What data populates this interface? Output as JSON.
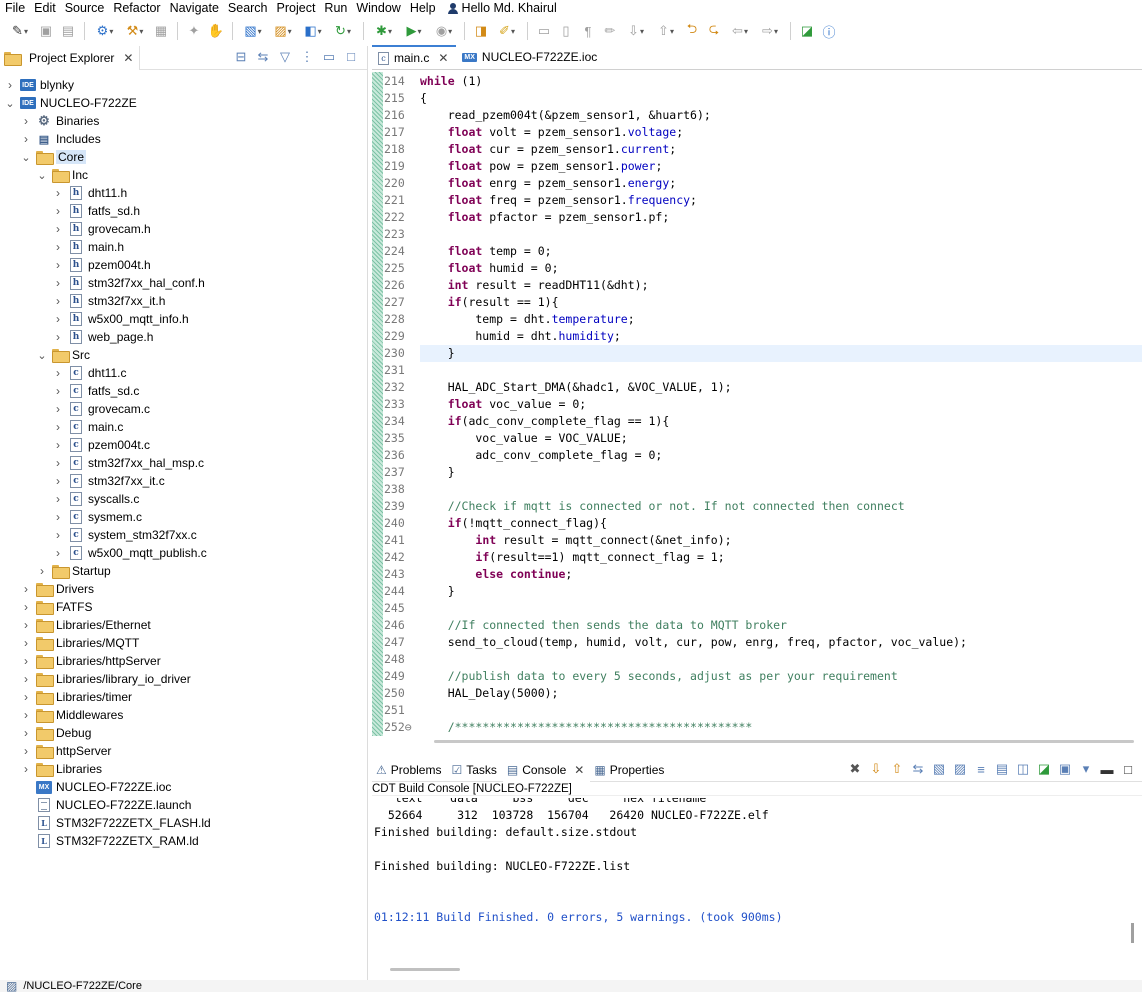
{
  "menu": [
    "File",
    "Edit",
    "Source",
    "Refactor",
    "Navigate",
    "Search",
    "Project",
    "Run",
    "Window",
    "Help"
  ],
  "user": "Hello Md. Khairul",
  "explorer": {
    "tab_title": "Project Explorer",
    "items": [
      {
        "label": "blynky",
        "twisty": ">",
        "icon": "ide",
        "indent": 0
      },
      {
        "label": "NUCLEO-F722ZE",
        "twisty": "v",
        "icon": "ide",
        "indent": 0
      },
      {
        "label": "Binaries",
        "twisty": ">",
        "icon": "binaries",
        "indent": 1
      },
      {
        "label": "Includes",
        "twisty": ">",
        "icon": "includes",
        "indent": 1
      },
      {
        "label": "Core",
        "twisty": "v",
        "icon": "folder",
        "indent": 1,
        "selected": true
      },
      {
        "label": "Inc",
        "twisty": "v",
        "icon": "folder",
        "indent": 2
      },
      {
        "label": "dht11.h",
        "twisty": ">",
        "icon": "h",
        "indent": 3
      },
      {
        "label": "fatfs_sd.h",
        "twisty": ">",
        "icon": "h",
        "indent": 3
      },
      {
        "label": "grovecam.h",
        "twisty": ">",
        "icon": "h",
        "indent": 3
      },
      {
        "label": "main.h",
        "twisty": ">",
        "icon": "h",
        "indent": 3
      },
      {
        "label": "pzem004t.h",
        "twisty": ">",
        "icon": "h",
        "indent": 3
      },
      {
        "label": "stm32f7xx_hal_conf.h",
        "twisty": ">",
        "icon": "h",
        "indent": 3
      },
      {
        "label": "stm32f7xx_it.h",
        "twisty": ">",
        "icon": "h",
        "indent": 3
      },
      {
        "label": "w5x00_mqtt_info.h",
        "twisty": ">",
        "icon": "h",
        "indent": 3
      },
      {
        "label": "web_page.h",
        "twisty": ">",
        "icon": "h",
        "indent": 3
      },
      {
        "label": "Src",
        "twisty": "v",
        "icon": "folder",
        "indent": 2
      },
      {
        "label": "dht11.c",
        "twisty": ">",
        "icon": "c",
        "indent": 3
      },
      {
        "label": "fatfs_sd.c",
        "twisty": ">",
        "icon": "c",
        "indent": 3
      },
      {
        "label": "grovecam.c",
        "twisty": ">",
        "icon": "c",
        "indent": 3
      },
      {
        "label": "main.c",
        "twisty": ">",
        "icon": "c",
        "indent": 3
      },
      {
        "label": "pzem004t.c",
        "twisty": ">",
        "icon": "c",
        "indent": 3
      },
      {
        "label": "stm32f7xx_hal_msp.c",
        "twisty": ">",
        "icon": "c",
        "indent": 3
      },
      {
        "label": "stm32f7xx_it.c",
        "twisty": ">",
        "icon": "c",
        "indent": 3
      },
      {
        "label": "syscalls.c",
        "twisty": ">",
        "icon": "c",
        "indent": 3
      },
      {
        "label": "sysmem.c",
        "twisty": ">",
        "icon": "c",
        "indent": 3
      },
      {
        "label": "system_stm32f7xx.c",
        "twisty": ">",
        "icon": "c",
        "indent": 3
      },
      {
        "label": "w5x00_mqtt_publish.c",
        "twisty": ">",
        "icon": "c",
        "indent": 3
      },
      {
        "label": "Startup",
        "twisty": ">",
        "icon": "folder",
        "indent": 2
      },
      {
        "label": "Drivers",
        "twisty": ">",
        "icon": "folder",
        "indent": 1
      },
      {
        "label": "FATFS",
        "twisty": ">",
        "icon": "folder",
        "indent": 1
      },
      {
        "label": "Libraries/Ethernet",
        "twisty": ">",
        "icon": "folder",
        "indent": 1
      },
      {
        "label": "Libraries/MQTT",
        "twisty": ">",
        "icon": "folder",
        "indent": 1
      },
      {
        "label": "Libraries/httpServer",
        "twisty": ">",
        "icon": "folder",
        "indent": 1
      },
      {
        "label": "Libraries/library_io_driver",
        "twisty": ">",
        "icon": "folder",
        "indent": 1
      },
      {
        "label": "Libraries/timer",
        "twisty": ">",
        "icon": "folder",
        "indent": 1
      },
      {
        "label": "Middlewares",
        "twisty": ">",
        "icon": "folder",
        "indent": 1
      },
      {
        "label": "Debug",
        "twisty": ">",
        "icon": "folder",
        "indent": 1
      },
      {
        "label": "httpServer",
        "twisty": ">",
        "icon": "folder",
        "indent": 1
      },
      {
        "label": "Libraries",
        "twisty": ">",
        "icon": "folder",
        "indent": 1
      },
      {
        "label": "NUCLEO-F722ZE.ioc",
        "twisty": "",
        "icon": "mx",
        "indent": 1
      },
      {
        "label": "NUCLEO-F722ZE.launch",
        "twisty": "",
        "icon": "doc",
        "indent": 1
      },
      {
        "label": "STM32F722ZETX_FLASH.ld",
        "twisty": "",
        "icon": "ld",
        "indent": 1
      },
      {
        "label": "STM32F722ZETX_RAM.ld",
        "twisty": "",
        "icon": "ld",
        "indent": 1
      }
    ]
  },
  "editor": {
    "tabs": [
      {
        "label": "main.c",
        "active": true
      },
      {
        "label": "NUCLEO-F722ZE.ioc",
        "active": false
      }
    ],
    "lines": [
      {
        "n": "214",
        "t": "while (1)"
      },
      {
        "n": "215",
        "t": "{"
      },
      {
        "n": "216",
        "t": "    read_pzem004t(&pzem_sensor1, &huart6);"
      },
      {
        "n": "217",
        "t": "    float volt = pzem_sensor1.voltage;"
      },
      {
        "n": "218",
        "t": "    float cur = pzem_sensor1.current;"
      },
      {
        "n": "219",
        "t": "    float pow = pzem_sensor1.power;"
      },
      {
        "n": "220",
        "t": "    float enrg = pzem_sensor1.energy;"
      },
      {
        "n": "221",
        "t": "    float freq = pzem_sensor1.frequency;"
      },
      {
        "n": "222",
        "t": "    float pfactor = pzem_sensor1.pf;"
      },
      {
        "n": "223",
        "t": ""
      },
      {
        "n": "224",
        "t": "    float temp = 0;"
      },
      {
        "n": "225",
        "t": "    float humid = 0;"
      },
      {
        "n": "226",
        "t": "    int result = readDHT11(&dht);"
      },
      {
        "n": "227",
        "t": "    if(result == 1){"
      },
      {
        "n": "228",
        "t": "        temp = dht.temperature;"
      },
      {
        "n": "229",
        "t": "        humid = dht.humidity;"
      },
      {
        "n": "230",
        "t": "    }"
      },
      {
        "n": "231",
        "t": ""
      },
      {
        "n": "232",
        "t": "    HAL_ADC_Start_DMA(&hadc1, &VOC_VALUE, 1);"
      },
      {
        "n": "233",
        "t": "    float voc_value = 0;"
      },
      {
        "n": "234",
        "t": "    if(adc_conv_complete_flag == 1){"
      },
      {
        "n": "235",
        "t": "        voc_value = VOC_VALUE;"
      },
      {
        "n": "236",
        "t": "        adc_conv_complete_flag = 0;"
      },
      {
        "n": "237",
        "t": "    }"
      },
      {
        "n": "238",
        "t": ""
      },
      {
        "n": "239",
        "t": "    //Check if mqtt is connected or not. If not connected then connect"
      },
      {
        "n": "240",
        "t": "    if(!mqtt_connect_flag){"
      },
      {
        "n": "241",
        "t": "        int result = mqtt_connect(&net_info);"
      },
      {
        "n": "242",
        "t": "        if(result==1) mqtt_connect_flag = 1;"
      },
      {
        "n": "243",
        "t": "        else continue;"
      },
      {
        "n": "244",
        "t": "    }"
      },
      {
        "n": "245",
        "t": ""
      },
      {
        "n": "246",
        "t": "    //If connected then sends the data to MQTT broker"
      },
      {
        "n": "247",
        "t": "    send_to_cloud(temp, humid, volt, cur, pow, enrg, freq, pfactor, voc_value);"
      },
      {
        "n": "248",
        "t": ""
      },
      {
        "n": "249",
        "t": "    //publish data to every 5 seconds, adjust as per your requirement"
      },
      {
        "n": "250",
        "t": "    HAL_Delay(5000);"
      },
      {
        "n": "251",
        "t": ""
      },
      {
        "n": "252⊖",
        "t": "    /*******************************************"
      }
    ]
  },
  "console": {
    "tabs": [
      "Problems",
      "Tasks",
      "Console",
      "Properties"
    ],
    "active_tab": "Console",
    "title": "CDT Build Console [NUCLEO-F722ZE]",
    "lines": [
      {
        "t": "   text    data     bss     dec     hex filename",
        "c": "plain"
      },
      {
        "t": "  52664     312  103728  156704   26420 NUCLEO-F722ZE.elf",
        "c": "plain"
      },
      {
        "t": "Finished building: default.size.stdout",
        "c": "plain"
      },
      {
        "t": "",
        "c": "plain"
      },
      {
        "t": "Finished building: NUCLEO-F722ZE.list",
        "c": "plain"
      },
      {
        "t": "",
        "c": "plain"
      },
      {
        "t": "",
        "c": "plain"
      },
      {
        "t": "01:12:11 Build Finished. 0 errors, 5 warnings. (took 900ms)",
        "c": "blue"
      }
    ]
  },
  "status": "/NUCLEO-F722ZE/Core",
  "colors": {
    "keyword": "#7f0055",
    "field": "#0000c0",
    "comment": "#3f7f5f",
    "build_finished": "#2050c8",
    "selection": "#d6e6f8",
    "current_line": "#e8f2fe"
  }
}
